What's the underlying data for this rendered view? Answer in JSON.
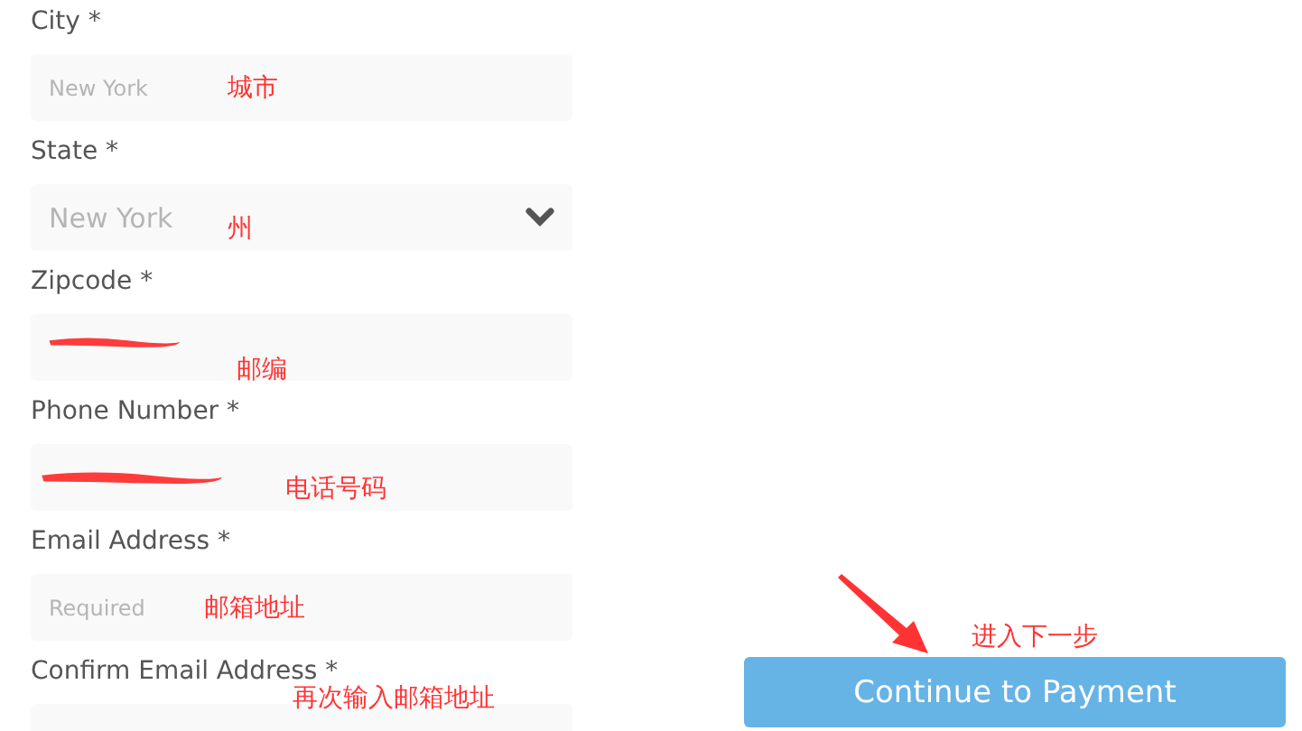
{
  "fields": [
    {
      "label": "City *",
      "kind": "text",
      "placeholder": "New York",
      "note": "城市"
    },
    {
      "label": "State *",
      "kind": "select",
      "placeholder": "New York",
      "note": "州"
    },
    {
      "label": "Zipcode *",
      "kind": "text",
      "redacted": true,
      "note": "邮编"
    },
    {
      "label": "Phone Number *",
      "kind": "text",
      "redacted": true,
      "note": "电话号码"
    },
    {
      "label": "Email Address *",
      "kind": "text",
      "placeholder": "Required",
      "note": "邮箱地址"
    },
    {
      "label": "Confirm Email Address *",
      "kind": "text",
      "note": "再次输入邮箱地址"
    }
  ],
  "continue_button": {
    "label": "Continue to Payment",
    "note": "进入下一步"
  }
}
